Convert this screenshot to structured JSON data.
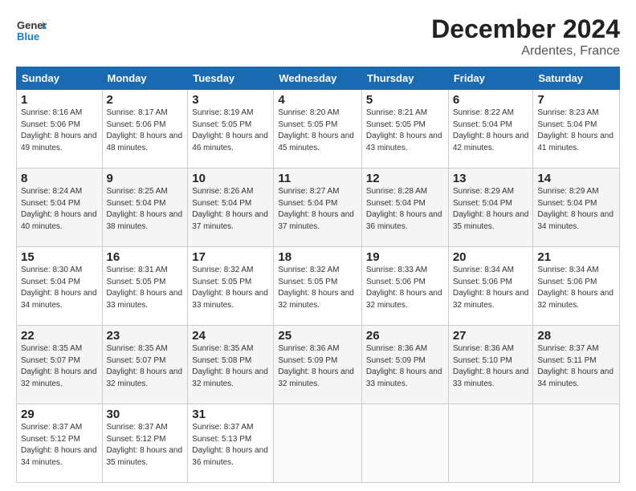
{
  "header": {
    "logo_general": "General",
    "logo_blue": "Blue",
    "title": "December 2024",
    "subtitle": "Ardentes, France"
  },
  "days_of_week": [
    "Sunday",
    "Monday",
    "Tuesday",
    "Wednesday",
    "Thursday",
    "Friday",
    "Saturday"
  ],
  "weeks": [
    [
      {
        "day": "1",
        "sunrise": "Sunrise: 8:16 AM",
        "sunset": "Sunset: 5:06 PM",
        "daylight": "Daylight: 8 hours and 49 minutes."
      },
      {
        "day": "2",
        "sunrise": "Sunrise: 8:17 AM",
        "sunset": "Sunset: 5:06 PM",
        "daylight": "Daylight: 8 hours and 48 minutes."
      },
      {
        "day": "3",
        "sunrise": "Sunrise: 8:19 AM",
        "sunset": "Sunset: 5:05 PM",
        "daylight": "Daylight: 8 hours and 46 minutes."
      },
      {
        "day": "4",
        "sunrise": "Sunrise: 8:20 AM",
        "sunset": "Sunset: 5:05 PM",
        "daylight": "Daylight: 8 hours and 45 minutes."
      },
      {
        "day": "5",
        "sunrise": "Sunrise: 8:21 AM",
        "sunset": "Sunset: 5:05 PM",
        "daylight": "Daylight: 8 hours and 43 minutes."
      },
      {
        "day": "6",
        "sunrise": "Sunrise: 8:22 AM",
        "sunset": "Sunset: 5:04 PM",
        "daylight": "Daylight: 8 hours and 42 minutes."
      },
      {
        "day": "7",
        "sunrise": "Sunrise: 8:23 AM",
        "sunset": "Sunset: 5:04 PM",
        "daylight": "Daylight: 8 hours and 41 minutes."
      }
    ],
    [
      {
        "day": "8",
        "sunrise": "Sunrise: 8:24 AM",
        "sunset": "Sunset: 5:04 PM",
        "daylight": "Daylight: 8 hours and 40 minutes."
      },
      {
        "day": "9",
        "sunrise": "Sunrise: 8:25 AM",
        "sunset": "Sunset: 5:04 PM",
        "daylight": "Daylight: 8 hours and 38 minutes."
      },
      {
        "day": "10",
        "sunrise": "Sunrise: 8:26 AM",
        "sunset": "Sunset: 5:04 PM",
        "daylight": "Daylight: 8 hours and 37 minutes."
      },
      {
        "day": "11",
        "sunrise": "Sunrise: 8:27 AM",
        "sunset": "Sunset: 5:04 PM",
        "daylight": "Daylight: 8 hours and 37 minutes."
      },
      {
        "day": "12",
        "sunrise": "Sunrise: 8:28 AM",
        "sunset": "Sunset: 5:04 PM",
        "daylight": "Daylight: 8 hours and 36 minutes."
      },
      {
        "day": "13",
        "sunrise": "Sunrise: 8:29 AM",
        "sunset": "Sunset: 5:04 PM",
        "daylight": "Daylight: 8 hours and 35 minutes."
      },
      {
        "day": "14",
        "sunrise": "Sunrise: 8:29 AM",
        "sunset": "Sunset: 5:04 PM",
        "daylight": "Daylight: 8 hours and 34 minutes."
      }
    ],
    [
      {
        "day": "15",
        "sunrise": "Sunrise: 8:30 AM",
        "sunset": "Sunset: 5:04 PM",
        "daylight": "Daylight: 8 hours and 34 minutes."
      },
      {
        "day": "16",
        "sunrise": "Sunrise: 8:31 AM",
        "sunset": "Sunset: 5:05 PM",
        "daylight": "Daylight: 8 hours and 33 minutes."
      },
      {
        "day": "17",
        "sunrise": "Sunrise: 8:32 AM",
        "sunset": "Sunset: 5:05 PM",
        "daylight": "Daylight: 8 hours and 33 minutes."
      },
      {
        "day": "18",
        "sunrise": "Sunrise: 8:32 AM",
        "sunset": "Sunset: 5:05 PM",
        "daylight": "Daylight: 8 hours and 32 minutes."
      },
      {
        "day": "19",
        "sunrise": "Sunrise: 8:33 AM",
        "sunset": "Sunset: 5:06 PM",
        "daylight": "Daylight: 8 hours and 32 minutes."
      },
      {
        "day": "20",
        "sunrise": "Sunrise: 8:34 AM",
        "sunset": "Sunset: 5:06 PM",
        "daylight": "Daylight: 8 hours and 32 minutes."
      },
      {
        "day": "21",
        "sunrise": "Sunrise: 8:34 AM",
        "sunset": "Sunset: 5:06 PM",
        "daylight": "Daylight: 8 hours and 32 minutes."
      }
    ],
    [
      {
        "day": "22",
        "sunrise": "Sunrise: 8:35 AM",
        "sunset": "Sunset: 5:07 PM",
        "daylight": "Daylight: 8 hours and 32 minutes."
      },
      {
        "day": "23",
        "sunrise": "Sunrise: 8:35 AM",
        "sunset": "Sunset: 5:07 PM",
        "daylight": "Daylight: 8 hours and 32 minutes."
      },
      {
        "day": "24",
        "sunrise": "Sunrise: 8:35 AM",
        "sunset": "Sunset: 5:08 PM",
        "daylight": "Daylight: 8 hours and 32 minutes."
      },
      {
        "day": "25",
        "sunrise": "Sunrise: 8:36 AM",
        "sunset": "Sunset: 5:09 PM",
        "daylight": "Daylight: 8 hours and 32 minutes."
      },
      {
        "day": "26",
        "sunrise": "Sunrise: 8:36 AM",
        "sunset": "Sunset: 5:09 PM",
        "daylight": "Daylight: 8 hours and 33 minutes."
      },
      {
        "day": "27",
        "sunrise": "Sunrise: 8:36 AM",
        "sunset": "Sunset: 5:10 PM",
        "daylight": "Daylight: 8 hours and 33 minutes."
      },
      {
        "day": "28",
        "sunrise": "Sunrise: 8:37 AM",
        "sunset": "Sunset: 5:11 PM",
        "daylight": "Daylight: 8 hours and 34 minutes."
      }
    ],
    [
      {
        "day": "29",
        "sunrise": "Sunrise: 8:37 AM",
        "sunset": "Sunset: 5:12 PM",
        "daylight": "Daylight: 8 hours and 34 minutes."
      },
      {
        "day": "30",
        "sunrise": "Sunrise: 8:37 AM",
        "sunset": "Sunset: 5:12 PM",
        "daylight": "Daylight: 8 hours and 35 minutes."
      },
      {
        "day": "31",
        "sunrise": "Sunrise: 8:37 AM",
        "sunset": "Sunset: 5:13 PM",
        "daylight": "Daylight: 8 hours and 36 minutes."
      },
      null,
      null,
      null,
      null
    ]
  ]
}
